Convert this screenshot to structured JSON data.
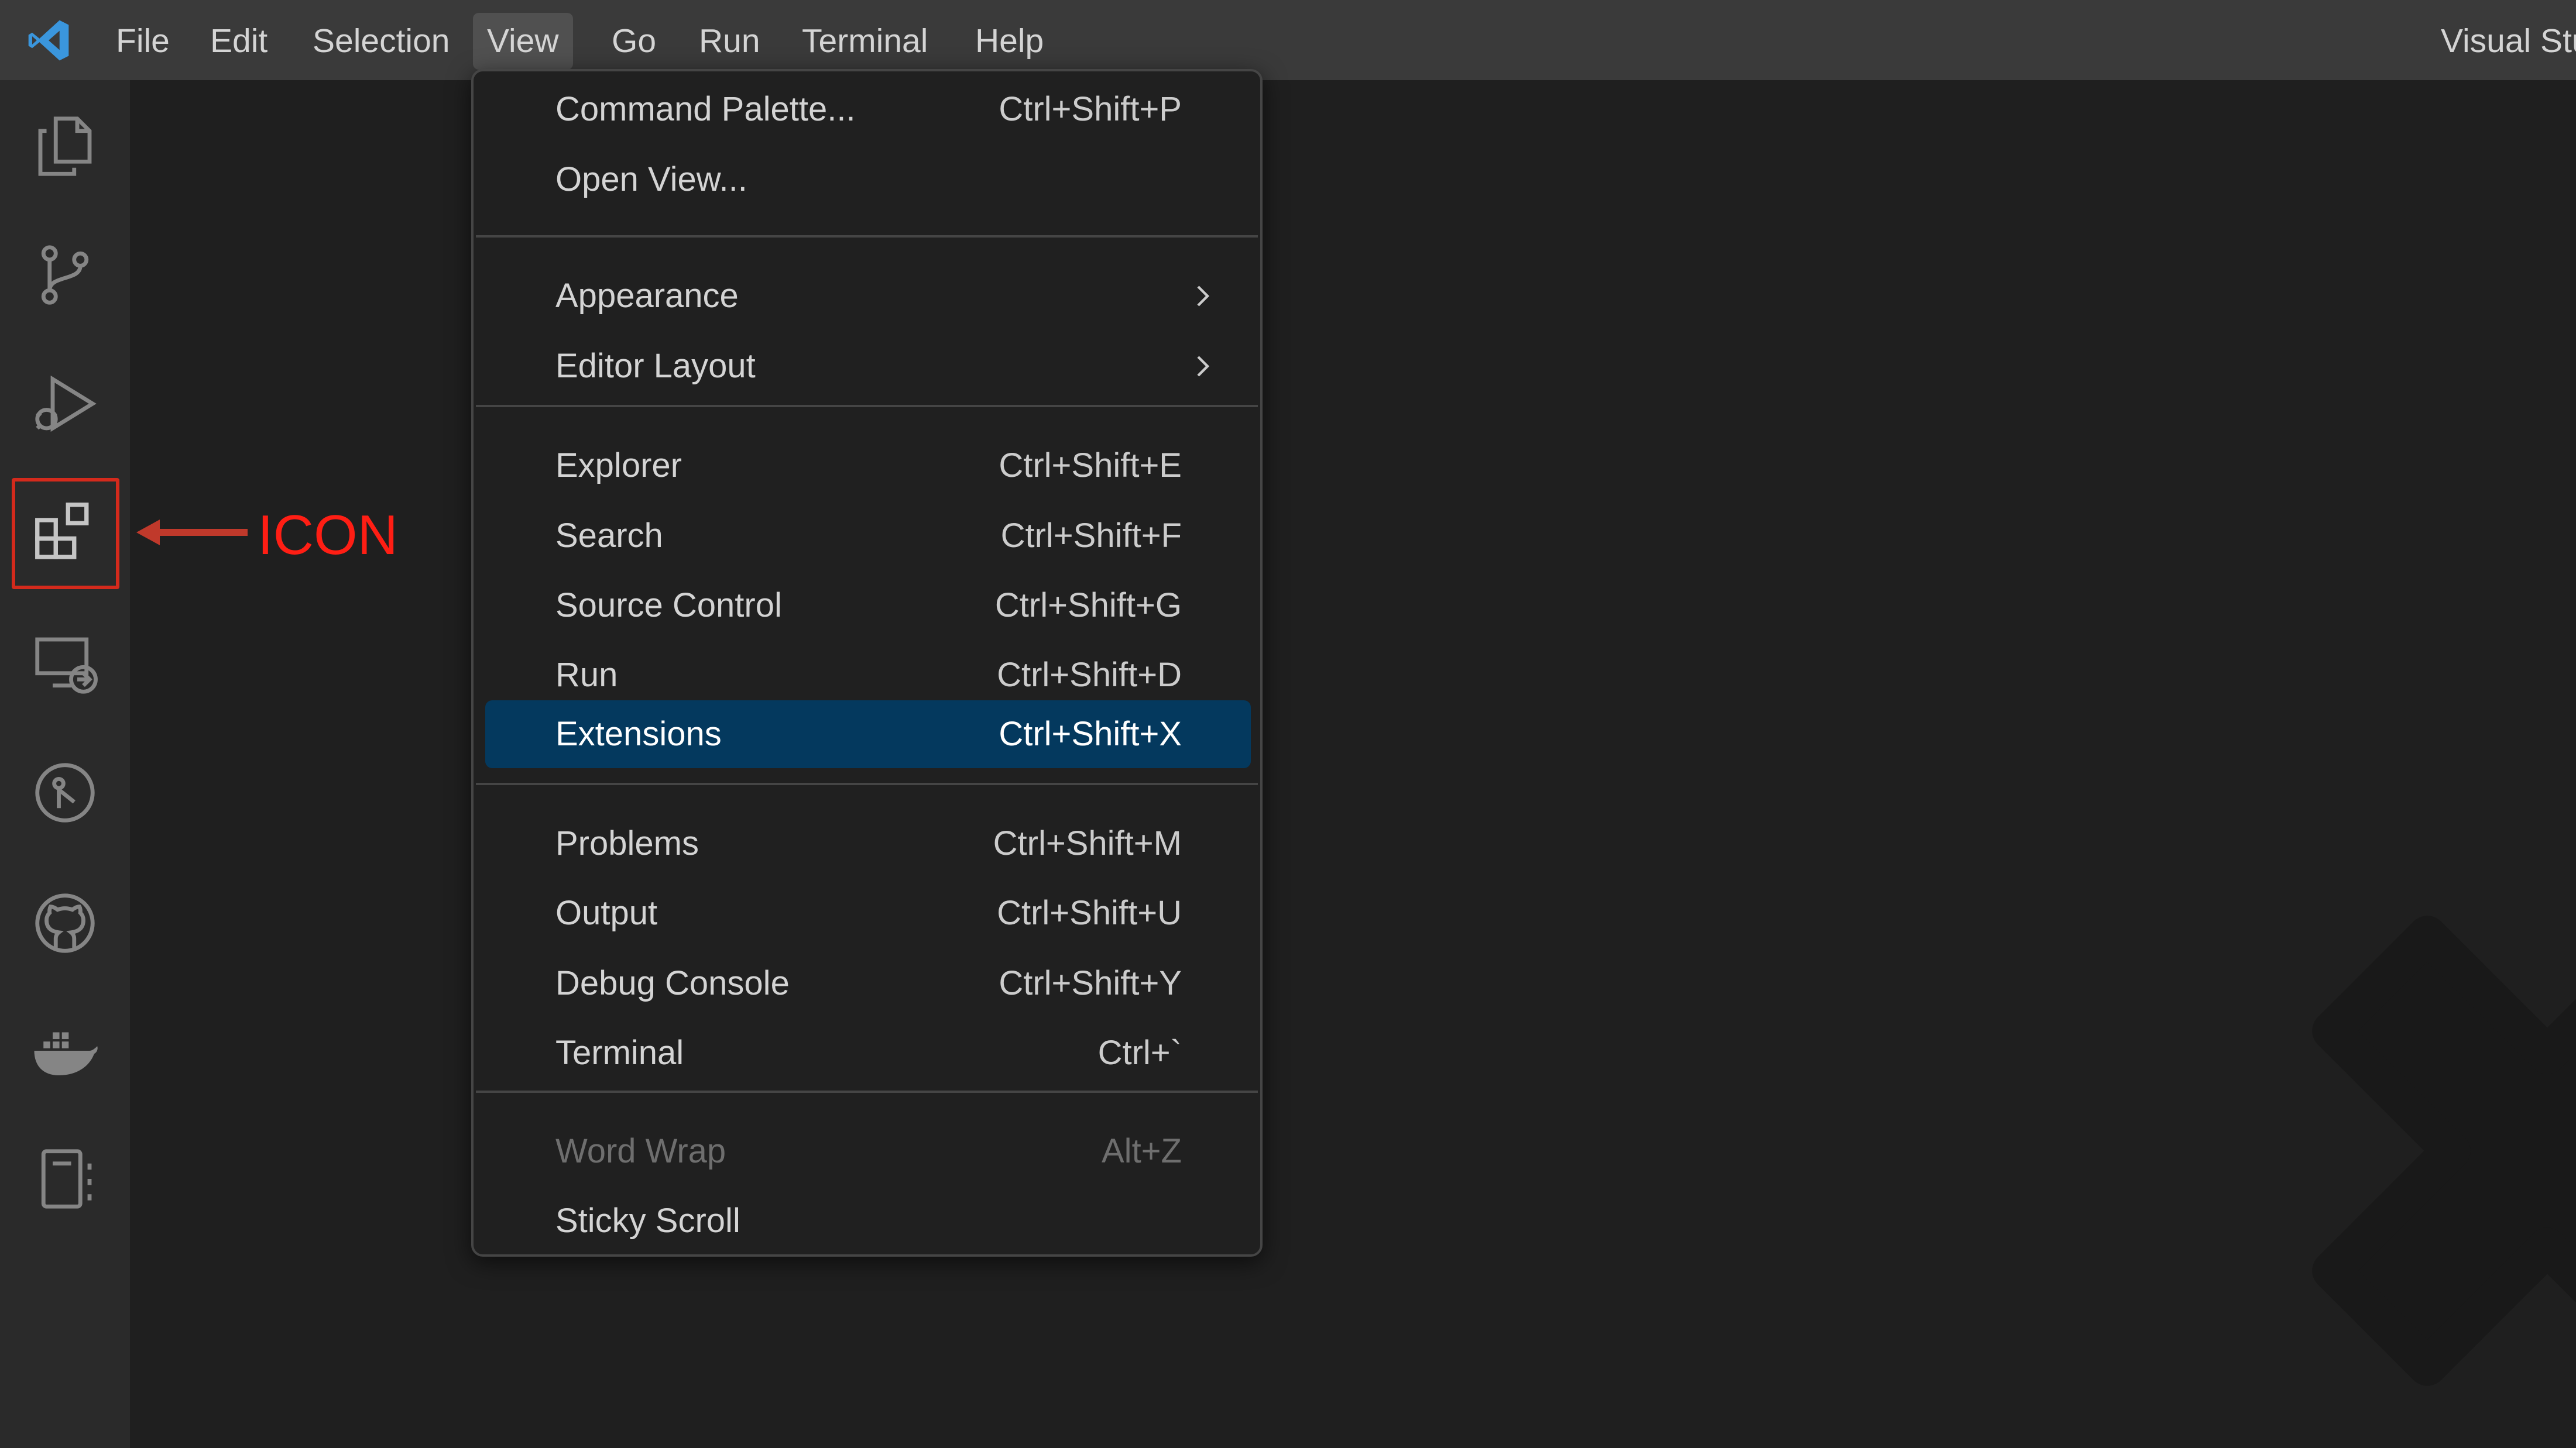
{
  "app": {
    "window_title": "Visual Stu"
  },
  "menubar": {
    "items": [
      "File",
      "Edit",
      "Selection",
      "View",
      "Go",
      "Run",
      "Terminal",
      "Help"
    ],
    "open_item": "View"
  },
  "activitybar": {
    "icons": [
      "explorer-icon",
      "source-control-icon",
      "run-debug-icon",
      "extensions-icon",
      "remote-explorer-icon",
      "gitlens-icon",
      "github-icon",
      "docker-icon",
      "notebook-icon"
    ],
    "highlighted": "extensions-icon"
  },
  "annotation": {
    "label": "ICON",
    "color": "#ff1e14"
  },
  "view_menu": {
    "groups": [
      [
        {
          "label": "Command Palette...",
          "shortcut": "Ctrl+Shift+P"
        },
        {
          "label": "Open View...",
          "shortcut": ""
        }
      ],
      [
        {
          "label": "Appearance",
          "shortcut": "",
          "submenu": true
        },
        {
          "label": "Editor Layout",
          "shortcut": "",
          "submenu": true
        }
      ],
      [
        {
          "label": "Explorer",
          "shortcut": "Ctrl+Shift+E"
        },
        {
          "label": "Search",
          "shortcut": "Ctrl+Shift+F"
        },
        {
          "label": "Source Control",
          "shortcut": "Ctrl+Shift+G"
        },
        {
          "label": "Run",
          "shortcut": "Ctrl+Shift+D"
        },
        {
          "label": "Extensions",
          "shortcut": "Ctrl+Shift+X",
          "selected": true
        }
      ],
      [
        {
          "label": "Problems",
          "shortcut": "Ctrl+Shift+M"
        },
        {
          "label": "Output",
          "shortcut": "Ctrl+Shift+U"
        },
        {
          "label": "Debug Console",
          "shortcut": "Ctrl+Shift+Y"
        },
        {
          "label": "Terminal",
          "shortcut": "Ctrl+`"
        }
      ],
      [
        {
          "label": "Word Wrap",
          "shortcut": "Alt+Z",
          "disabled": true
        },
        {
          "label": "Sticky Scroll",
          "shortcut": ""
        }
      ]
    ]
  },
  "colors": {
    "accent_selected": "#04395e",
    "logo_blue": "#3a96dd",
    "highlight_border": "#d42a1c"
  }
}
